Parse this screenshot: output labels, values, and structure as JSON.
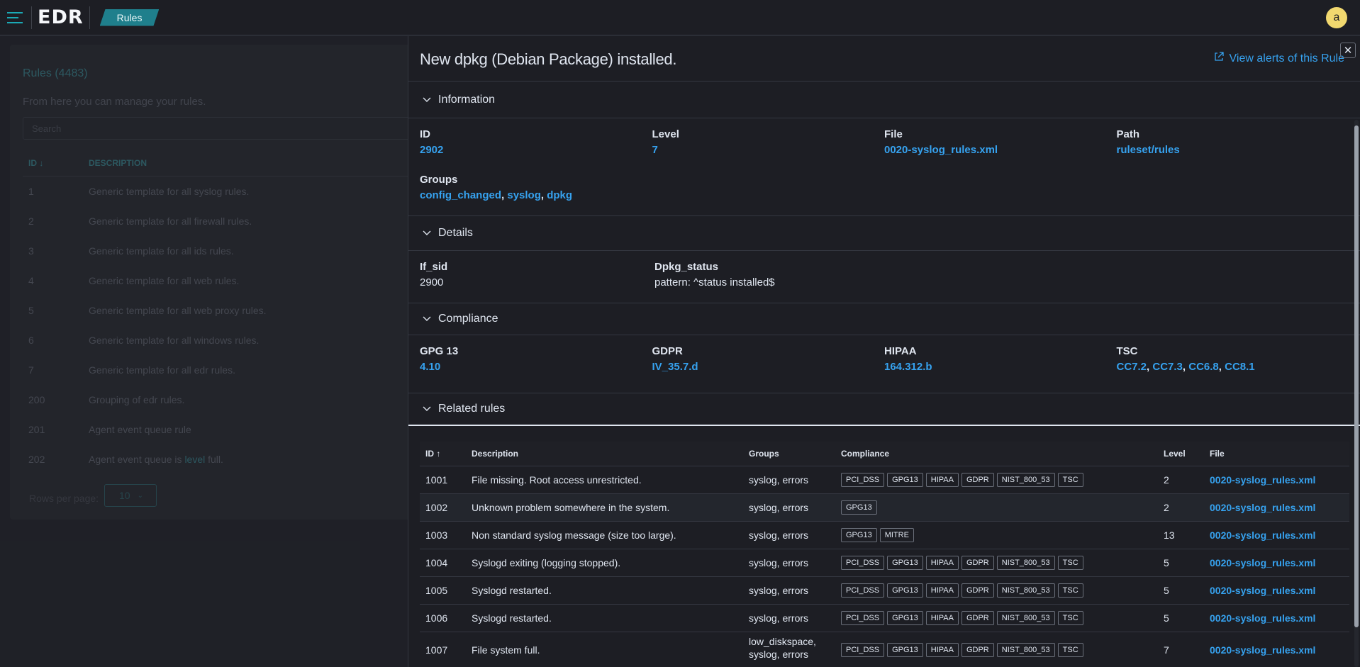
{
  "topbar": {
    "brand": "EDR",
    "breadcrumb": "Rules",
    "avatar": "a"
  },
  "background": {
    "title": "Rules (4483)",
    "subtitle": "From here you can manage your rules.",
    "search_placeholder": "Search",
    "columns": [
      "ID ↓",
      "DESCRIPTION"
    ],
    "rows": [
      {
        "id": "1",
        "desc": "Generic template for all syslog rules."
      },
      {
        "id": "2",
        "desc": "Generic template for all firewall rules."
      },
      {
        "id": "3",
        "desc": "Generic template for all ids rules."
      },
      {
        "id": "4",
        "desc": "Generic template for all web rules."
      },
      {
        "id": "5",
        "desc": "Generic template for all web proxy rules."
      },
      {
        "id": "6",
        "desc": "Generic template for all windows rules."
      },
      {
        "id": "7",
        "desc": "Generic template for all edr rules."
      },
      {
        "id": "200",
        "desc": "Grouping of edr rules."
      },
      {
        "id": "201",
        "desc": "Agent event queue rule"
      }
    ],
    "last_row": {
      "id": "202",
      "pre": "Agent event queue is ",
      "level": "level",
      "post": " full."
    },
    "rows_per_page_label": "Rows per page:",
    "rows_per_page_value": "10"
  },
  "flyout": {
    "title": "New dpkg (Debian Package) installed.",
    "view_alerts": "View alerts of this Rule",
    "information": {
      "heading": "Information",
      "id_label": "ID",
      "id_value": "2902",
      "level_label": "Level",
      "level_value": "7",
      "file_label": "File",
      "file_value": "0020-syslog_rules.xml",
      "path_label": "Path",
      "path_value": "ruleset/rules",
      "groups_label": "Groups",
      "groups": [
        "config_changed",
        "syslog",
        "dpkg"
      ]
    },
    "details": {
      "heading": "Details",
      "ifsid_label": "If_sid",
      "ifsid_value": "2900",
      "dpkg_label": "Dpkg_status",
      "dpkg_value": "pattern: ^status installed$"
    },
    "compliance": {
      "heading": "Compliance",
      "gpg_label": "GPG 13",
      "gpg_value": "4.10",
      "gdpr_label": "GDPR",
      "gdpr_value": "IV_35.7.d",
      "hipaa_label": "HIPAA",
      "hipaa_value": "164.312.b",
      "tsc_label": "TSC",
      "tsc_values": [
        "CC7.2",
        "CC7.3",
        "CC6.8",
        "CC8.1"
      ]
    },
    "related": {
      "heading": "Related rules",
      "columns": {
        "id": "ID",
        "description": "Description",
        "groups": "Groups",
        "compliance": "Compliance",
        "level": "Level",
        "file": "File"
      },
      "rows": [
        {
          "id": "1001",
          "description": "File missing. Root access unrestricted.",
          "groups": "syslog, errors",
          "compliance": [
            "PCI_DSS",
            "GPG13",
            "HIPAA",
            "GDPR",
            "NIST_800_53",
            "TSC"
          ],
          "level": "2",
          "file": "0020-syslog_rules.xml"
        },
        {
          "id": "1002",
          "description": "Unknown problem somewhere in the system.",
          "groups": "syslog, errors",
          "compliance": [
            "GPG13"
          ],
          "level": "2",
          "file": "0020-syslog_rules.xml"
        },
        {
          "id": "1003",
          "description": "Non standard syslog message (size too large).",
          "groups": "syslog, errors",
          "compliance": [
            "GPG13",
            "MITRE"
          ],
          "level": "13",
          "file": "0020-syslog_rules.xml"
        },
        {
          "id": "1004",
          "description": "Syslogd exiting (logging stopped).",
          "groups": "syslog, errors",
          "compliance": [
            "PCI_DSS",
            "GPG13",
            "HIPAA",
            "GDPR",
            "NIST_800_53",
            "TSC"
          ],
          "level": "5",
          "file": "0020-syslog_rules.xml"
        },
        {
          "id": "1005",
          "description": "Syslogd restarted.",
          "groups": "syslog, errors",
          "compliance": [
            "PCI_DSS",
            "GPG13",
            "HIPAA",
            "GDPR",
            "NIST_800_53",
            "TSC"
          ],
          "level": "5",
          "file": "0020-syslog_rules.xml"
        },
        {
          "id": "1006",
          "description": "Syslogd restarted.",
          "groups": "syslog, errors",
          "compliance": [
            "PCI_DSS",
            "GPG13",
            "HIPAA",
            "GDPR",
            "NIST_800_53",
            "TSC"
          ],
          "level": "5",
          "file": "0020-syslog_rules.xml"
        },
        {
          "id": "1007",
          "description": "File system full.",
          "groups": "low_diskspace, syslog, errors",
          "compliance": [
            "PCI_DSS",
            "GPG13",
            "HIPAA",
            "GDPR",
            "NIST_800_53",
            "TSC"
          ],
          "level": "7",
          "file": "0020-syslog_rules.xml"
        }
      ]
    }
  }
}
